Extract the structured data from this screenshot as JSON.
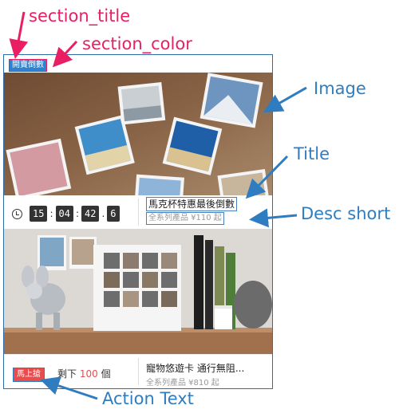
{
  "annotations": {
    "section_title": "section_title",
    "section_color": "section_color",
    "image": "Image",
    "title": "Title",
    "desc_short": "Desc short",
    "action_text": "Action Text"
  },
  "card": {
    "section_title": "開賣倒數",
    "section_color": "#2f82d0",
    "item1": {
      "countdown": [
        "15",
        "04",
        "42",
        "6"
      ],
      "title": "馬克杯特惠最後倒數",
      "desc": "全系列產品 ¥110 起"
    },
    "item2": {
      "action_text": "馬上搶",
      "remain_prefix": "剩下",
      "remain_count": "100",
      "remain_suffix": "個",
      "title": "寵物悠遊卡 通行無阻...",
      "desc": "全系列產品 ¥810 起"
    }
  },
  "colors": {
    "annotation_pink": "#e91e63",
    "annotation_blue": "#2f7dc0",
    "action_red": "#e84c4c"
  }
}
